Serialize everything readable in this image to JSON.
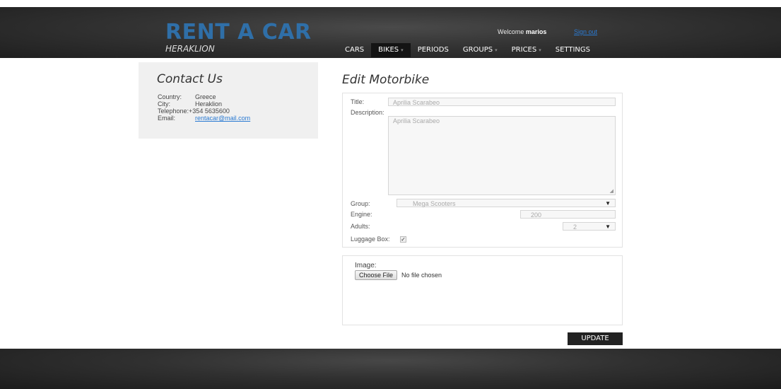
{
  "header": {
    "logo_title": "RENT A CAR",
    "logo_subtitle": "HERAKLION",
    "welcome_text": "Welcome",
    "username": "marios",
    "signout_label": "Sign out",
    "brand_color": "#2f6fa8",
    "nav": [
      {
        "label": "CARS",
        "active": false
      },
      {
        "label": "BIKES",
        "active": true
      },
      {
        "label": "PERIODS",
        "active": false
      },
      {
        "label": "GROUPS",
        "active": false
      },
      {
        "label": "PRICES",
        "active": false
      },
      {
        "label": "SETTINGS",
        "active": false
      }
    ]
  },
  "sidebar": {
    "heading": "Contact Us",
    "country_label": "Country:",
    "country_value": "Greece",
    "city_label": "City:",
    "city_value": "Heraklion",
    "telephone_label": "Telephone:",
    "telephone_value": "+354 5635600",
    "email_label": "Email:",
    "email_value": "rentacar@mail.com"
  },
  "form": {
    "heading": "Edit Motorbike",
    "title_label": "Title:",
    "title_value": "Aprilia Scarabeo",
    "description_label": "Description:",
    "description_value": "Aprilia Scarabeo",
    "group_label": "Group:",
    "group_value": "Mega Scooters",
    "engine_label": "Engine:",
    "engine_value": "200",
    "adults_label": "Adults:",
    "adults_value": "2",
    "luggage_label": "Luggage Box:",
    "luggage_checked": true
  },
  "image_upload": {
    "label": "Image:",
    "button_label": "Choose File",
    "status": "No file chosen"
  },
  "update_label": "UPDATE"
}
